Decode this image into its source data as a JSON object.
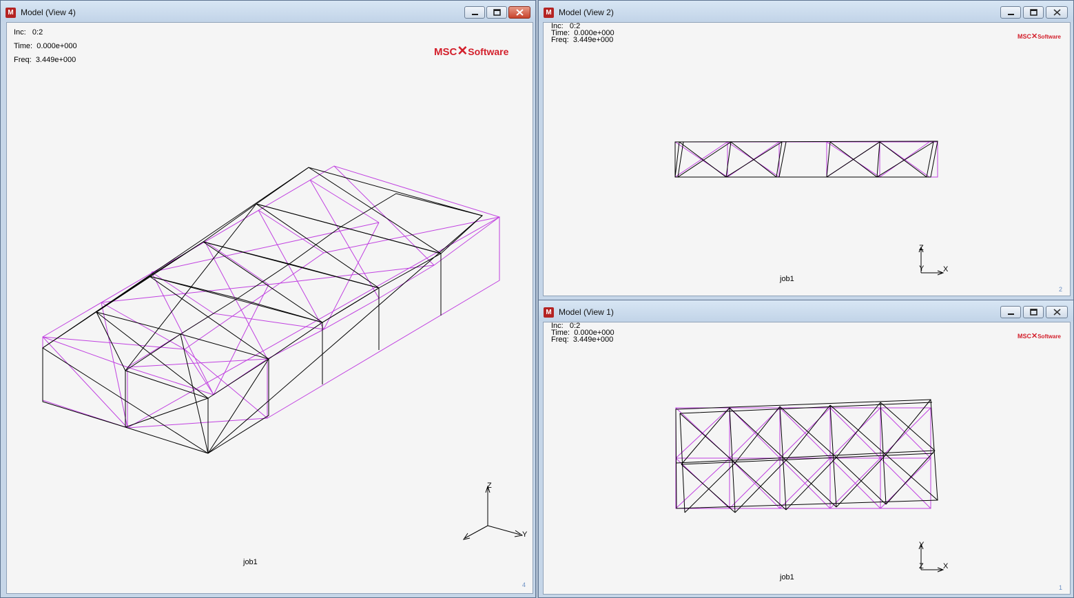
{
  "windows": {
    "view4": {
      "title": "Model (View 4)",
      "inc_label": "Inc:",
      "inc_value": "0:2",
      "time_label": "Time:",
      "time_value": "0.000e+000",
      "freq_label": "Freq:",
      "freq_value": "3.449e+000",
      "job": "job1",
      "view_number": "4",
      "axes": [
        "Z",
        "Y"
      ]
    },
    "view2": {
      "title": "Model (View 2)",
      "inc_label": "Inc:",
      "inc_value": "0:2",
      "time_label": "Time:",
      "time_value": "0.000e+000",
      "freq_label": "Freq:",
      "freq_value": "3.449e+000",
      "job": "job1",
      "view_number": "2",
      "axes": [
        "Z",
        "Y",
        "X"
      ]
    },
    "view1": {
      "title": "Model (View 1)",
      "inc_label": "Inc:",
      "inc_value": "0:2",
      "time_label": "Time:",
      "time_value": "0.000e+000",
      "freq_label": "Freq:",
      "freq_value": "3.449e+000",
      "job": "job1",
      "view_number": "1",
      "axes": [
        "Y",
        "Z",
        "X"
      ]
    }
  },
  "logo": {
    "msc": "MSC",
    "software": "Software"
  },
  "app_icon_letter": "M",
  "colors": {
    "deformed_mesh": "#000000",
    "undeformed_mesh": "#c040e0",
    "logo_red": "#d3202c",
    "viewport_bg": "#f5f5f5"
  },
  "icons": [
    "minimize-icon",
    "restore-icon",
    "close-icon",
    "app-icon"
  ]
}
